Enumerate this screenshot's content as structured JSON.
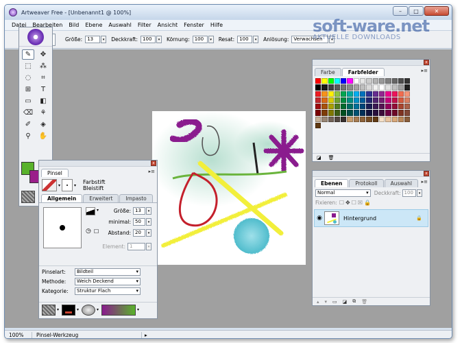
{
  "window": {
    "title": "Artweaver Free - [Unbenannt1 @ 100%]",
    "min": "–",
    "max": "□",
    "close": "✕"
  },
  "menu": [
    "Datei",
    "Bearbeiten",
    "Bild",
    "Ebene",
    "Auswahl",
    "Filter",
    "Ansicht",
    "Fenster",
    "Hilfe"
  ],
  "watermark": {
    "brand": "soft-ware.net",
    "tagline": "AKTUELLE DOWNLOADS"
  },
  "options": {
    "size_label": "Größe:",
    "size_value": "13",
    "opacity_label": "Deckkraft:",
    "opacity_value": "100",
    "grain_label": "Körnung:",
    "grain_value": "100",
    "resat_label": "Resat:",
    "resat_value": "100",
    "pressure_label": "Anlösung:",
    "pressure_value": "Verwachsen"
  },
  "status": {
    "zoom": "100%",
    "tool": "Pinsel-Werkzeug",
    "arrow": "▸"
  },
  "colors": {
    "fg": "#59b22b",
    "bg": "#9a1e8a"
  },
  "swatch_panel": {
    "tab1": "Farbe",
    "tab2": "Farbfelder"
  },
  "swatch_palette": [
    "#ff0000",
    "#ffff00",
    "#00ff00",
    "#00ffff",
    "#0000ff",
    "#ff00ff",
    "#ffffff",
    "#e6e6e6",
    "#cccccc",
    "#b3b3b3",
    "#999999",
    "#808080",
    "#666666",
    "#4d4d4d",
    "#333333",
    "#000000",
    "#1a1a1a",
    "#404040",
    "#595959",
    "#737373",
    "#8c8c8c",
    "#a6a6a6",
    "#bfbfbf",
    "#d9d9d9",
    "#f2f2f2",
    "#ffffff",
    "#e0e0e0",
    "#c0c0c0",
    "#a0a0a0",
    "#202020",
    "#ee1c24",
    "#f7941d",
    "#fff200",
    "#8dc63f",
    "#00a651",
    "#00a99d",
    "#00aeef",
    "#0072bc",
    "#2e3192",
    "#662d91",
    "#92278f",
    "#ec008c",
    "#ed145b",
    "#f26c4f",
    "#f69679",
    "#c1272d",
    "#d96a17",
    "#d9cc00",
    "#6fa22e",
    "#008a3e",
    "#008c80",
    "#008fc5",
    "#005b9a",
    "#23266f",
    "#4f2270",
    "#741e70",
    "#c4007a",
    "#c20f4a",
    "#d45a3e",
    "#d97f63",
    "#9e0b0f",
    "#a7510c",
    "#a9a000",
    "#507c1f",
    "#006b2f",
    "#006d63",
    "#006f99",
    "#004479",
    "#1a1c54",
    "#3b1854",
    "#561453",
    "#93005b",
    "#930b37",
    "#a8452f",
    "#aa6149",
    "#790000",
    "#7d3c08",
    "#7f7800",
    "#3c5c14",
    "#004f21",
    "#004f48",
    "#005171",
    "#002f58",
    "#11123c",
    "#280f3c",
    "#3c0d3b",
    "#6b0042",
    "#6c0727",
    "#7e3322",
    "#804736",
    "#c7b299",
    "#998675",
    "#736357",
    "#534741",
    "#362f2d",
    "#c69c6d",
    "#a67c52",
    "#8c6239",
    "#754c24",
    "#603913",
    "#f5e0c8",
    "#e8c39e",
    "#d9a87a",
    "#ba8759",
    "#8a5e3b",
    "#603913"
  ],
  "brush_panel": {
    "title": "Pinsel",
    "category": "Farbstift",
    "variant": "Bleistift",
    "tabs": [
      "Allgemein",
      "Erweitert",
      "Impasto"
    ],
    "size_label": "Größe:",
    "size_value": "13",
    "min_label": "minimal:",
    "min_value": "50",
    "spacing_label": "Abstand:",
    "spacing_value": "20",
    "element_label": "Element:",
    "element_value": "1",
    "type_label": "Pinselart:",
    "type_value": "Bildteil",
    "method_label": "Methode:",
    "method_value": "Weich Deckend",
    "cat_label": "Kategorie:",
    "cat_value": "Struktur Flach"
  },
  "layers_panel": {
    "tabs": [
      "Ebenen",
      "Protokoll",
      "Auswahl"
    ],
    "mode": "Normal",
    "opacity_label": "Deckkraft:",
    "opacity_value": "100",
    "fix_label": "Fixieren:",
    "layer_name": "Hintergrund"
  }
}
